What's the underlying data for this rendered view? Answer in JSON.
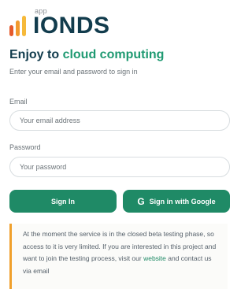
{
  "logo": {
    "app_label": "app",
    "name": "IONDS"
  },
  "colors": {
    "brand_dark": "#123c4d",
    "accent_green": "#1f9a72",
    "button_green": "#1f8a66",
    "notice_border": "#f0a02c",
    "logo_bar_colors": [
      "#e55a2b",
      "#f29a2e",
      "#f6b93a"
    ]
  },
  "heading": {
    "prefix": "Enjoy to",
    "accent": "cloud computing"
  },
  "subtitle": "Enter your email and password to sign in",
  "form": {
    "email_label": "Email",
    "email_placeholder": "Your email address",
    "password_label": "Password",
    "password_placeholder": "Your password"
  },
  "buttons": {
    "signin_label": "Sign In",
    "google_icon": "G",
    "google_label": "Sign in with Google"
  },
  "notice": {
    "text_before": "At the moment the service is in the closed beta testing phase, so access to it is very limited. If you are interested in this project and want to join the testing process, visit our ",
    "link_text": "website",
    "text_after": " and contact us via email"
  }
}
